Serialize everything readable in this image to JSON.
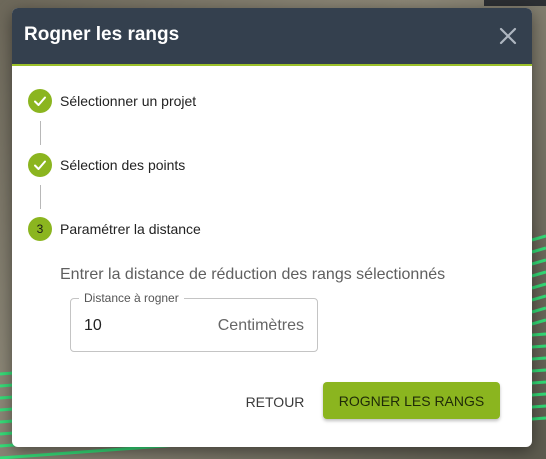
{
  "dialog": {
    "title": "Rogner les rangs",
    "close_icon": "close-icon"
  },
  "stepper": {
    "steps": [
      {
        "label": "Sélectionner un projet",
        "status": "completed",
        "icon": "check-icon"
      },
      {
        "label": "Sélection des points",
        "status": "completed",
        "icon": "check-icon"
      },
      {
        "label": "Paramétrer la distance",
        "status": "active",
        "number": "3"
      }
    ]
  },
  "form": {
    "instruction": "Entrer la distance de réduction des rangs sélectionnés",
    "distance_label": "Distance à rogner",
    "distance_value": "10",
    "distance_unit": "Centimètres"
  },
  "actions": {
    "back_label": "RETOUR",
    "submit_label": "ROGNER LES RANGS"
  },
  "colors": {
    "header_bg": "#34404e",
    "accent": "#8bb51f",
    "row_lines": "#2ee87a"
  }
}
